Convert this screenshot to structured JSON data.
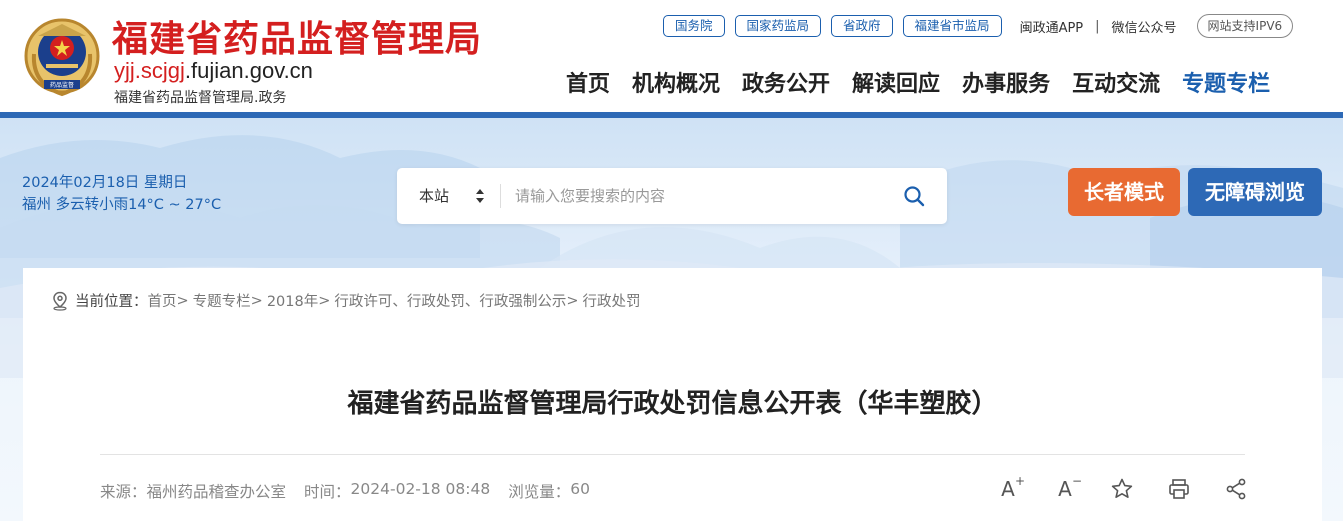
{
  "header": {
    "site_name": "福建省药品监督管理局",
    "domain_prefix": "yjj.scjgj",
    "domain_suffix": ".fujian.gov.cn",
    "site_suffix": "福建省药品监督管理局.政务",
    "emblem_caption": "药品监督"
  },
  "top_links": [
    "国务院",
    "国家药监局",
    "省政府",
    "福建省市监局"
  ],
  "top_text": {
    "app": "闽政通APP",
    "separator": "|",
    "wechat": "微信公众号",
    "ipv6": "网站支持IPV6"
  },
  "main_nav": [
    "首页",
    "机构概况",
    "政务公开",
    "解读回应",
    "办事服务",
    "互动交流",
    "专题专栏"
  ],
  "info": {
    "date": "2024年02月18日 星期日",
    "weather": "福州 多云转小雨14°C ~ 27°C"
  },
  "search": {
    "scope": "本站",
    "placeholder": "请输入您要搜索的内容"
  },
  "buttons": {
    "elder_mode": "长者模式",
    "accessibility": "无障碍浏览"
  },
  "breadcrumb": {
    "label": "当前位置：",
    "items": [
      "首页",
      "专题专栏",
      "2018年",
      "行政许可、行政处罚、行政强制公示",
      "行政处罚"
    ],
    "separator": ">"
  },
  "article": {
    "title": "福建省药品监督管理局行政处罚信息公开表（华丰塑胶）",
    "source_label": "来源：",
    "source": "福州药品稽查办公室",
    "time_label": "时间：",
    "time": "2024-02-18 08:48",
    "views_label": "浏览量：",
    "views": "60"
  },
  "tools": {
    "font_increase": "A",
    "font_increase_mark": "+",
    "font_decrease": "A",
    "font_decrease_mark": "−"
  },
  "colors": {
    "brand_red": "#d41f1f",
    "brand_blue": "#1b5fae",
    "elder_orange": "#e86a32",
    "header_line": "#2d69b6"
  }
}
